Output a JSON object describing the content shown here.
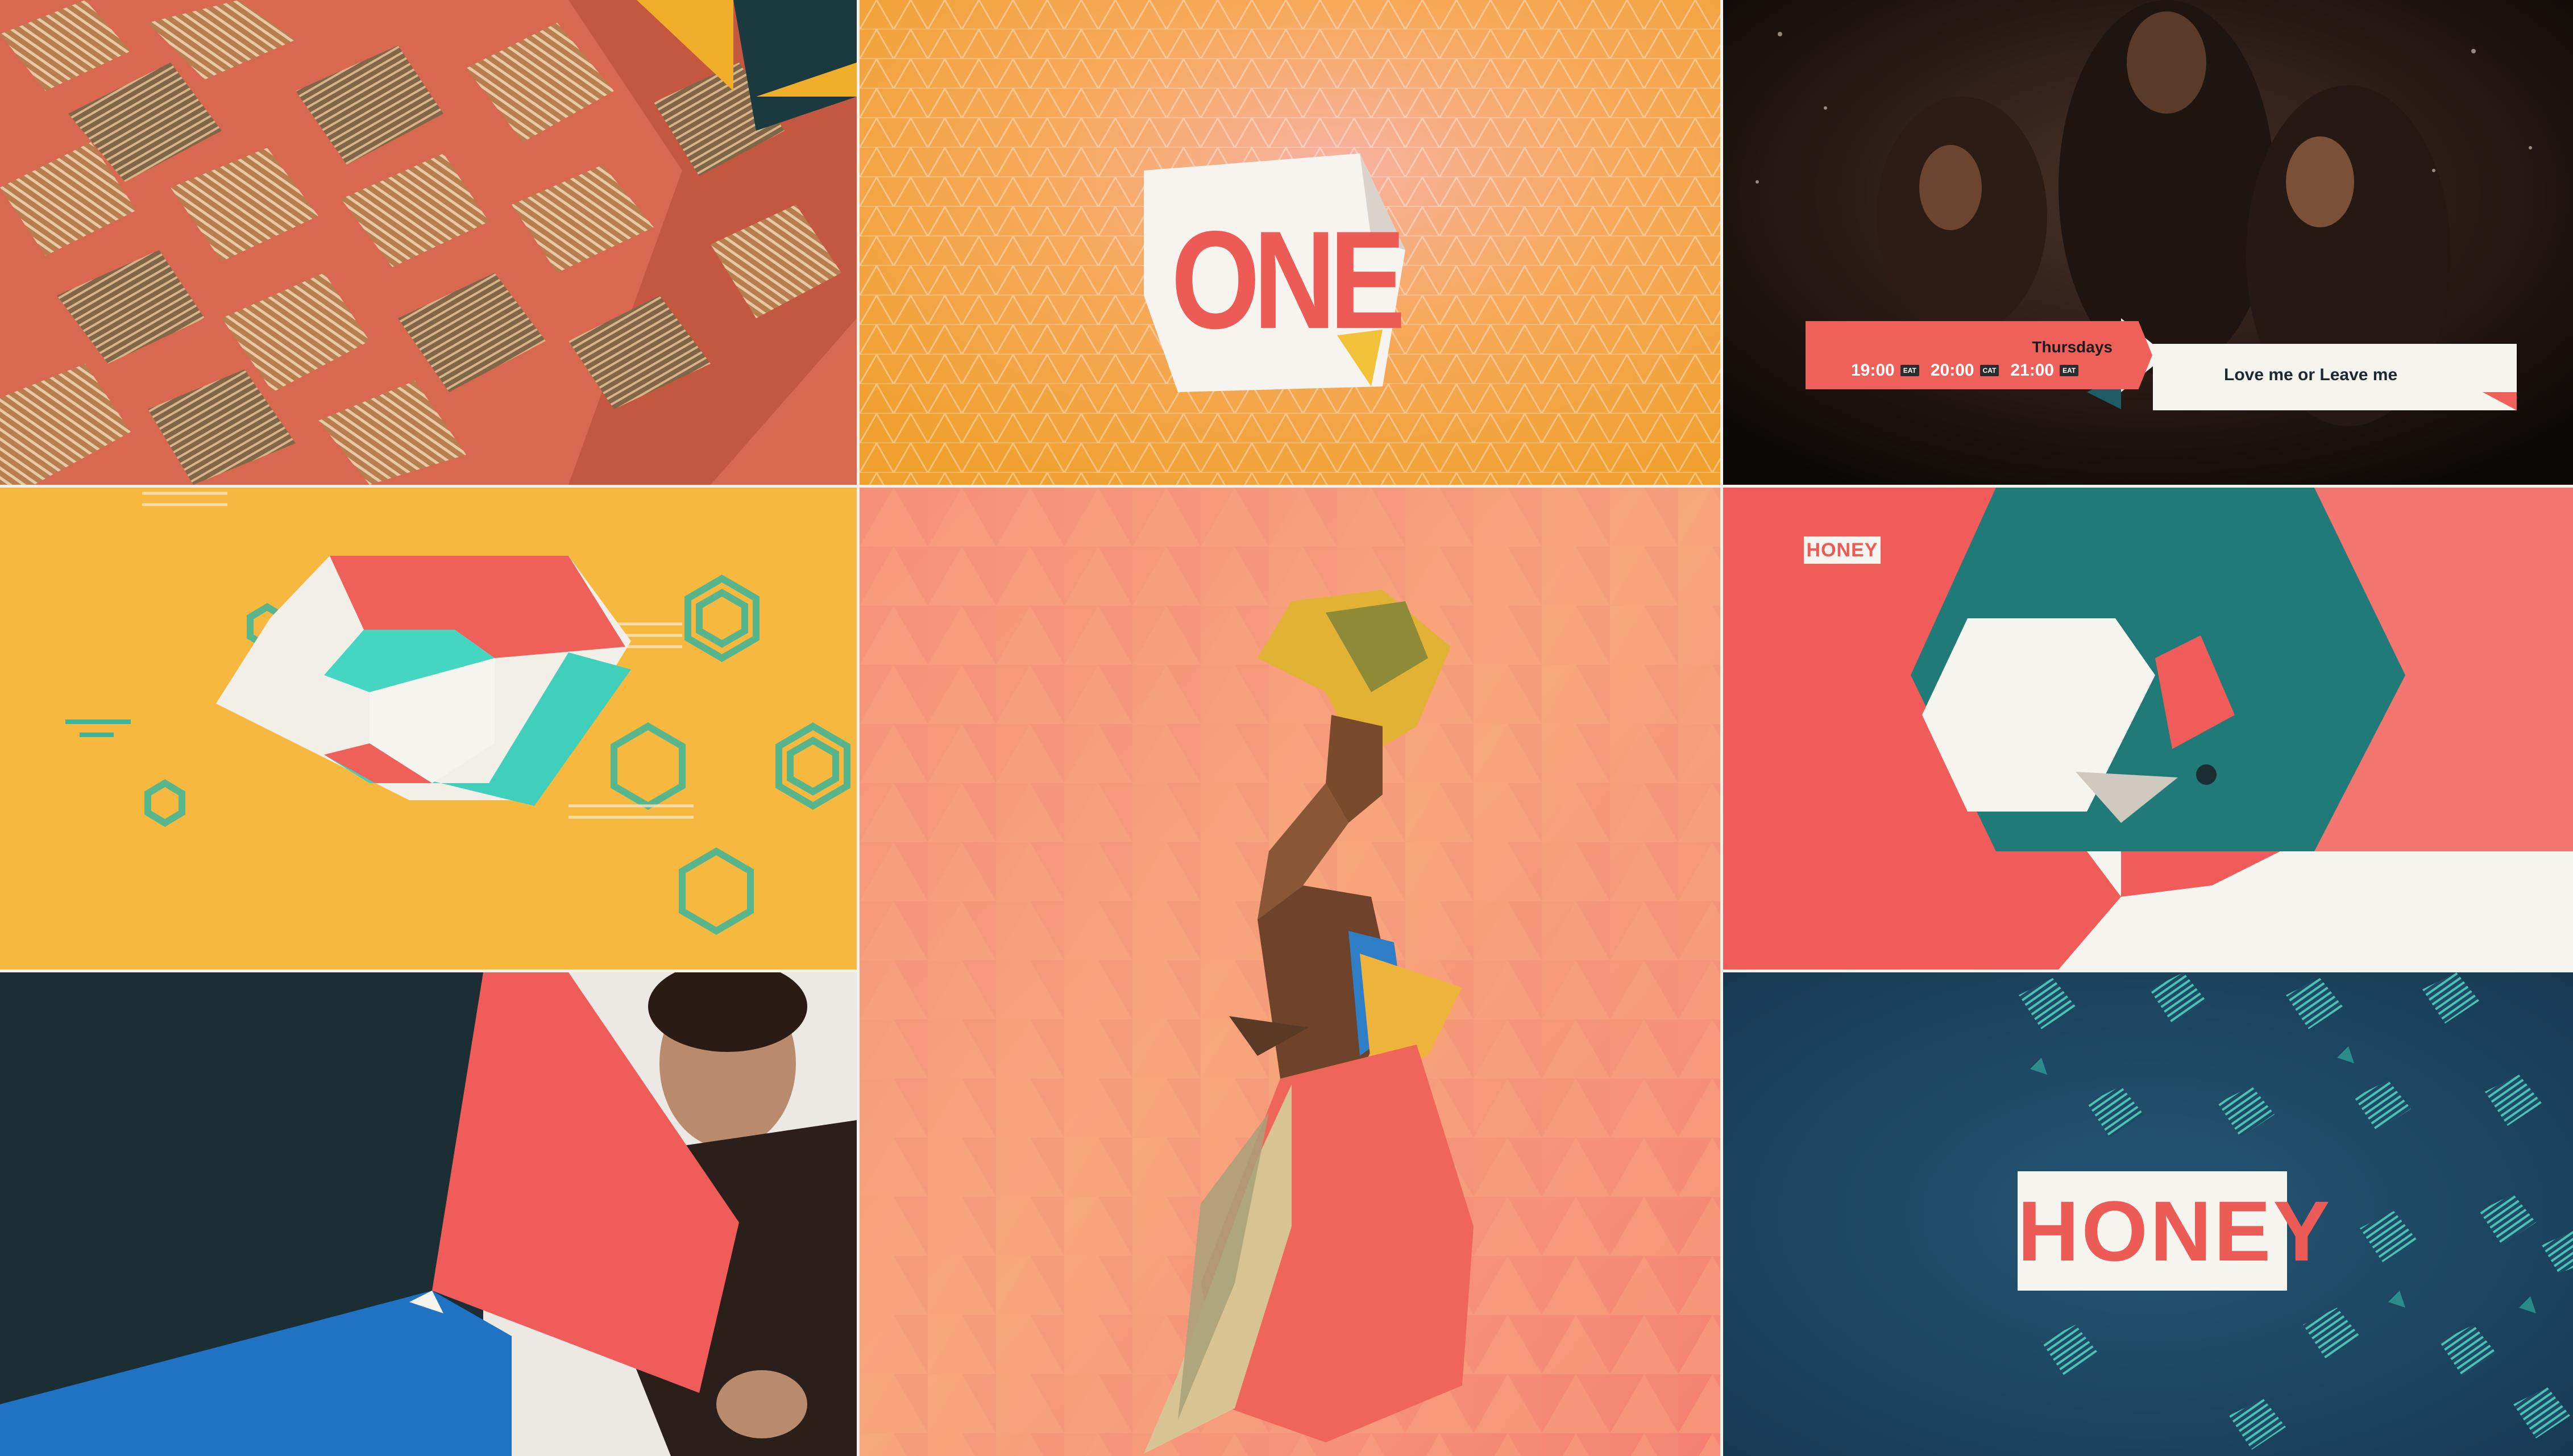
{
  "brand": {
    "one_logo": "ONE",
    "honey_small": "HONEY",
    "honey_large": "HONEY"
  },
  "schedule": {
    "day": "Thursdays",
    "times": [
      {
        "time": "19:00",
        "zone": "EAT"
      },
      {
        "time": "20:00",
        "zone": "CAT"
      },
      {
        "time": "21:00",
        "zone": "EAT"
      }
    ],
    "show_title": "Love me or Leave me"
  },
  "colors": {
    "coral": "#f0605a",
    "amber": "#f6b53a",
    "teal": "#1f7a78",
    "navy": "#1c4a66",
    "turquoise": "#45d4c0",
    "cream": "#f6f4ef",
    "dark": "#1a2e33"
  }
}
